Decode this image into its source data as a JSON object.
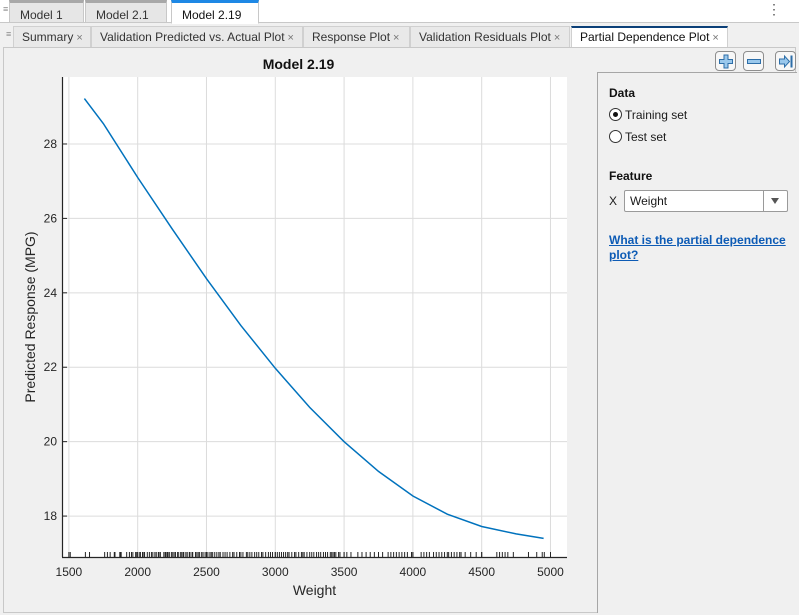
{
  "doc_tabs": [
    {
      "label": "Model 1",
      "active": false
    },
    {
      "label": "Model 2.1",
      "active": false
    },
    {
      "label": "Model 2.19",
      "active": true
    }
  ],
  "plot_tabs": [
    {
      "label": "Summary",
      "active": false
    },
    {
      "label": "Validation Predicted vs. Actual Plot",
      "active": false
    },
    {
      "label": "Response Plot",
      "active": false
    },
    {
      "label": "Validation Residuals Plot",
      "active": false
    },
    {
      "label": "Partial Dependence Plot",
      "active": true
    }
  ],
  "close_glyph": "×",
  "menu_glyph": "⋮",
  "toolbar": {
    "icons": [
      "zoom-in-icon",
      "zoom-out-icon",
      "collapse-panel-icon"
    ]
  },
  "side_panel": {
    "data_heading": "Data",
    "data_options": [
      {
        "label": "Training set",
        "checked": true
      },
      {
        "label": "Test set",
        "checked": false
      }
    ],
    "feature_heading": "Feature",
    "feature_axis_label": "X",
    "feature_value": "Weight",
    "help_link": "What is the partial dependence plot?"
  },
  "chart_data": {
    "type": "line",
    "title": "Model 2.19",
    "xlabel": "Weight",
    "ylabel": "Predicted Response (MPG)",
    "xlim": [
      1450,
      5120
    ],
    "ylim": [
      16.9,
      29.8
    ],
    "xticks": [
      1500,
      2000,
      2500,
      3000,
      3500,
      4000,
      4500,
      5000
    ],
    "yticks": [
      18,
      20,
      22,
      24,
      26,
      28
    ],
    "grid": true,
    "series": [
      {
        "name": "Partial dependence",
        "color": "#0072bd",
        "x": [
          1613,
          1750,
          2000,
          2250,
          2500,
          2750,
          3000,
          3250,
          3500,
          3750,
          4000,
          4250,
          4500,
          4750,
          4950
        ],
        "y": [
          29.22,
          28.55,
          27.1,
          25.72,
          24.38,
          23.12,
          21.97,
          20.92,
          20.0,
          19.2,
          18.54,
          18.05,
          17.72,
          17.52,
          17.4
        ]
      }
    ],
    "rug_x": [
      1510,
      1620,
      1650,
      1760,
      1780,
      1800,
      1830,
      1835,
      1870,
      1875,
      1880,
      1920,
      1940,
      1955,
      1965,
      1985,
      1990,
      2000,
      2015,
      2020,
      2035,
      2045,
      2050,
      2070,
      2085,
      2100,
      2110,
      2125,
      2135,
      2150,
      2155,
      2165,
      2190,
      2200,
      2205,
      2215,
      2220,
      2230,
      2245,
      2255,
      2265,
      2275,
      2290,
      2295,
      2310,
      2320,
      2330,
      2335,
      2350,
      2360,
      2375,
      2380,
      2395,
      2400,
      2420,
      2430,
      2440,
      2450,
      2465,
      2475,
      2490,
      2500,
      2510,
      2525,
      2535,
      2545,
      2560,
      2575,
      2590,
      2600,
      2620,
      2635,
      2650,
      2670,
      2690,
      2700,
      2720,
      2740,
      2750,
      2765,
      2790,
      2800,
      2815,
      2830,
      2850,
      2865,
      2880,
      2900,
      2910,
      2930,
      2950,
      2965,
      2980,
      3000,
      3015,
      3030,
      3045,
      3060,
      3075,
      3090,
      3100,
      3120,
      3140,
      3150,
      3170,
      3190,
      3200,
      3210,
      3230,
      3250,
      3265,
      3280,
      3300,
      3315,
      3330,
      3350,
      3365,
      3380,
      3400,
      3410,
      3420,
      3430,
      3440,
      3460,
      3470,
      3500,
      3520,
      3550,
      3600,
      3630,
      3660,
      3690,
      3720,
      3750,
      3780,
      3820,
      3840,
      3860,
      3880,
      3900,
      3920,
      3940,
      3960,
      3990,
      4000,
      4060,
      4080,
      4100,
      4120,
      4150,
      4170,
      4190,
      4210,
      4230,
      4250,
      4260,
      4280,
      4300,
      4320,
      4340,
      4350,
      4380,
      4420,
      4460,
      4500,
      4610,
      4630,
      4650,
      4670,
      4690,
      4730,
      4840,
      4900,
      4940,
      4955
    ]
  }
}
